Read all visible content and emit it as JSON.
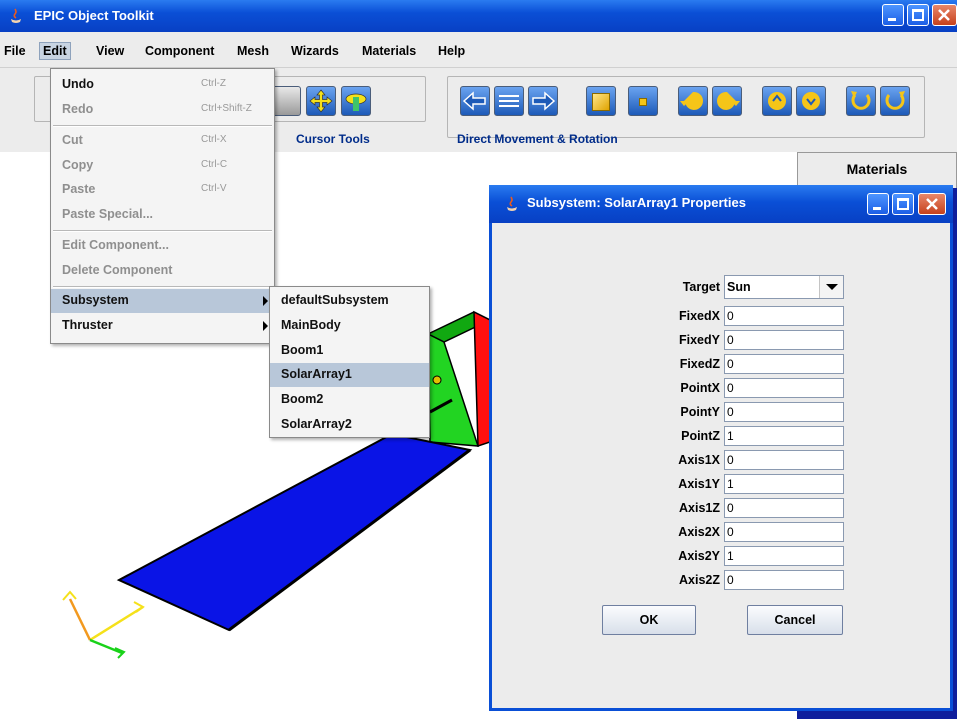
{
  "window": {
    "title": "EPIC Object Toolkit"
  },
  "menubar": [
    "File",
    "Edit",
    "View",
    "Component",
    "Mesh",
    "Wizards",
    "Materials",
    "Help"
  ],
  "toolbar": {
    "cursor_label": "Cursor Tools",
    "movement_label": "Direct Movement & Rotation"
  },
  "materials_tab": "Materials",
  "edit_menu": {
    "items": [
      {
        "label": "Undo",
        "accel": "Ctrl-Z",
        "enabled": true
      },
      {
        "label": "Redo",
        "accel": "Ctrl+Shift-Z",
        "enabled": false
      },
      {
        "label": "Cut",
        "accel": "Ctrl-X",
        "enabled": false
      },
      {
        "label": "Copy",
        "accel": "Ctrl-C",
        "enabled": false
      },
      {
        "label": "Paste",
        "accel": "Ctrl-V",
        "enabled": false
      },
      {
        "label": "Paste Special...",
        "accel": "",
        "enabled": false
      },
      {
        "label": "Edit Component...",
        "accel": "",
        "enabled": false
      },
      {
        "label": "Delete Component",
        "accel": "",
        "enabled": false
      },
      {
        "label": "Subsystem",
        "accel": "",
        "enabled": true
      },
      {
        "label": "Thruster",
        "accel": "",
        "enabled": true
      }
    ]
  },
  "subsystem_menu": {
    "items": [
      "defaultSubsystem",
      "MainBody",
      "Boom1",
      "SolarArray1",
      "Boom2",
      "SolarArray2"
    ],
    "highlighted": "SolarArray1"
  },
  "dialog": {
    "title": "Subsystem: SolarArray1 Properties",
    "target_label": "Target",
    "target_value": "Sun",
    "fields": [
      {
        "label": "FixedX",
        "value": "0"
      },
      {
        "label": "FixedY",
        "value": "0"
      },
      {
        "label": "FixedZ",
        "value": "0"
      },
      {
        "label": "PointX",
        "value": "0"
      },
      {
        "label": "PointY",
        "value": "0"
      },
      {
        "label": "PointZ",
        "value": "1"
      },
      {
        "label": "Axis1X",
        "value": "0"
      },
      {
        "label": "Axis1Y",
        "value": "1"
      },
      {
        "label": "Axis1Z",
        "value": "0"
      },
      {
        "label": "Axis2X",
        "value": "0"
      },
      {
        "label": "Axis2Y",
        "value": "1"
      },
      {
        "label": "Axis2Z",
        "value": "0"
      }
    ],
    "ok_label": "OK",
    "cancel_label": "Cancel"
  },
  "colors": {
    "titlebar": "#0a4fd6",
    "panel_blue": "#0f1e9c",
    "solar_array": "#0a14e6"
  }
}
